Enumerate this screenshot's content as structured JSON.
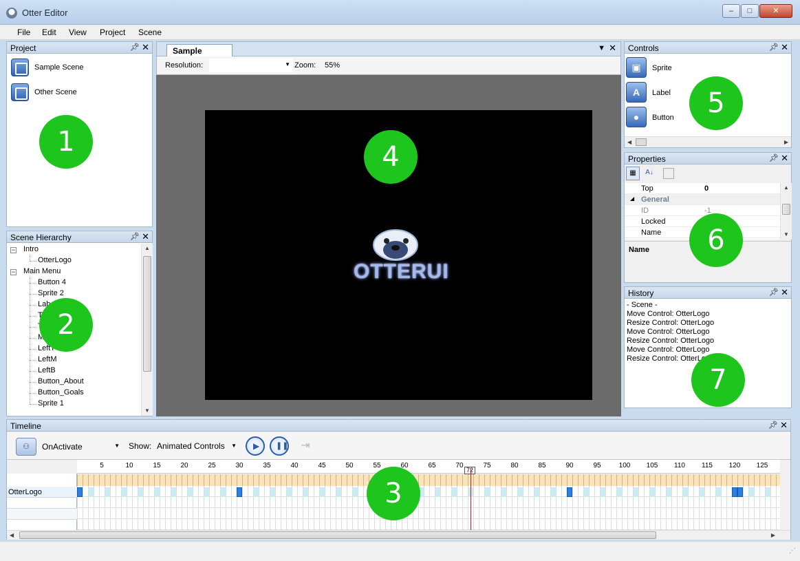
{
  "window": {
    "title": "Otter Editor",
    "minimize": "‒",
    "maximize": "□",
    "close": "✕"
  },
  "menu": [
    "File",
    "Edit",
    "View",
    "Project",
    "Scene"
  ],
  "project": {
    "title": "Project",
    "items": [
      "Sample Scene",
      "Other Scene"
    ],
    "badge": "1"
  },
  "hierarchy": {
    "title": "Scene Hierarchy",
    "groups": [
      {
        "label": "Intro",
        "children": [
          "OtterLogo"
        ]
      },
      {
        "label": "Main Menu",
        "children": [
          "Button 4",
          "Sprite 2",
          "Lab",
          "T",
          "T",
          "Men",
          "LeftT",
          "LeftM",
          "LeftB",
          "Button_About",
          "Button_Goals",
          "Sprite 1"
        ]
      }
    ],
    "badge": "2"
  },
  "scene": {
    "tab": "Sample Scene",
    "resolution_label": "Resolution:",
    "resolution_value": "",
    "zoom_label": "Zoom:",
    "zoom_value": "55%",
    "logo_text": "OTTERUI",
    "badge": "4"
  },
  "controls": {
    "title": "Controls",
    "items": [
      {
        "label": "Sprite",
        "icon": "sprite-icon",
        "glyph": "▣"
      },
      {
        "label": "Label",
        "icon": "label-icon",
        "glyph": "A"
      },
      {
        "label": "Button",
        "icon": "button-icon",
        "glyph": "●"
      }
    ],
    "badge": "5"
  },
  "properties": {
    "title": "Properties",
    "rows": [
      {
        "name": "Top",
        "value": "0"
      },
      {
        "name": "General",
        "value": "",
        "category": true
      },
      {
        "name": "ID",
        "value": "-1"
      },
      {
        "name": "Locked",
        "value": ""
      },
      {
        "name": "Name",
        "value": ""
      }
    ],
    "description_title": "Name",
    "badge": "6"
  },
  "history": {
    "title": "History",
    "entries": [
      "- Scene -",
      "Move Control: OtterLogo",
      "Resize Control: OtterLogo",
      "Move Control: OtterLogo",
      "Resize Control: OtterLogo",
      "Move Control: OtterLogo",
      "Resize Control: OtterLogo"
    ],
    "badge": "7"
  },
  "timeline": {
    "title": "Timeline",
    "animation": "OnActivate",
    "show_label": "Show:",
    "show_value": "Animated Controls",
    "ticks": [
      "5",
      "10",
      "15",
      "20",
      "25",
      "30",
      "35",
      "40",
      "45",
      "50",
      "55",
      "60",
      "65",
      "70",
      "75",
      "80",
      "85",
      "90",
      "95",
      "100",
      "105",
      "110",
      "115",
      "120",
      "125"
    ],
    "current_frame": "72",
    "track": "OtterLogo",
    "keyframes": [
      1,
      30,
      90,
      120,
      121
    ],
    "badge": "3"
  },
  "colors": {
    "badge": "#1dc51d",
    "keyframe": "#2d7fe0",
    "playhead": "#b22222"
  }
}
